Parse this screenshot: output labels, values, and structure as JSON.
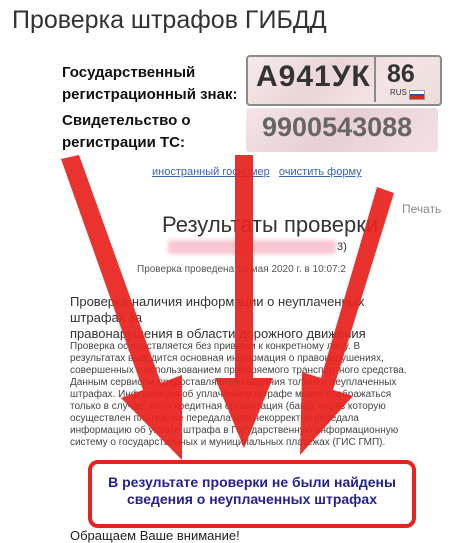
{
  "page_title": "Проверка штрафов ГИБДД",
  "form": {
    "plate_label_1": "Государственный",
    "plate_label_2": "регистрационный знак:",
    "plate_number": "А941УК",
    "plate_region": "86",
    "plate_country": "RUS",
    "sts_label_1": "Свидетельство о",
    "sts_label_2": "регистрации ТС:",
    "sts_number": "9900543088",
    "link_foreign": "иностранный госномер",
    "link_clear": "очистить форму"
  },
  "results": {
    "print_label": "Печать",
    "title": "Результаты проверки",
    "blurred_tail": "3)",
    "date": "Проверка проведена 19 мая 2020 г. в 10:07:2",
    "heading_1": "Проверка наличия информации о неуплаченных штрафах за",
    "heading_2": "правонарушения в области дорожного движения",
    "body": [
      "Проверка осуществляется без привязки к конкретному лицу. В",
      "результатах выводится основная информация о правонарушениях,",
      "совершенных с использованием проверяемого транспортного средства.",
      "Данным сервисом предоставляются сведения только о неуплаченных",
      "штрафах. Информация об уплаченном штрафе может отображаться",
      "только в случае, если кредитная организация (банк), через которую",
      "осуществлен платеж, не передала или некорректно передала",
      "информацию об уплате штрафа в Государственную информационную",
      "систему о государственных и муниципальных платежах (ГИС ГМП)."
    ],
    "result_line_1": "В результате проверки не были найдены",
    "result_line_2": "сведения о неуплаченных штрафах",
    "attention": "Обращаем Ваше внимание!"
  },
  "colors": {
    "arrow": "#e8231f",
    "result_text": "#23238c",
    "link": "#3a63b8"
  }
}
